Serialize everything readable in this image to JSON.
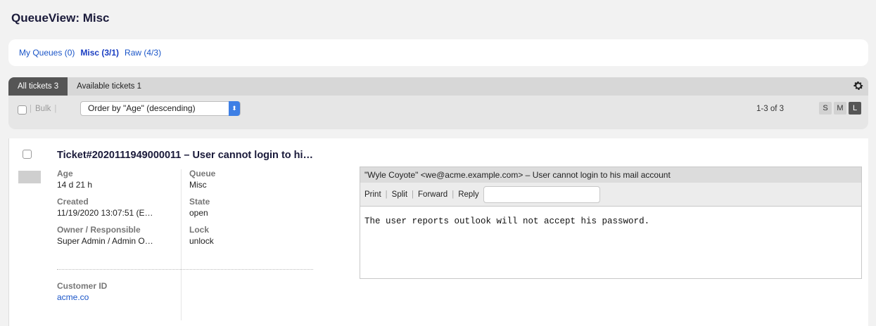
{
  "page": {
    "title": "QueueView: Misc"
  },
  "queues": [
    {
      "label": "My Queues (0)",
      "active": false
    },
    {
      "label": "Misc (3/1)",
      "active": true
    },
    {
      "label": "Raw (4/3)",
      "active": false
    }
  ],
  "tabs": {
    "all": "All tickets 3",
    "available": "Available tickets 1"
  },
  "toolbar": {
    "bulk_label": "Bulk",
    "order_by": "Order by \"Age\" (descending)",
    "pagination": "1-3 of 3",
    "sizes": [
      "S",
      "M",
      "L"
    ],
    "active_size": "L"
  },
  "ticket": {
    "title": "Ticket#2020111949000011 – User cannot login to hi…",
    "age_label": "Age",
    "age": "14 d 21 h",
    "created_label": "Created",
    "created": "11/19/2020 13:07:51 (E…",
    "owner_label": "Owner / Responsible",
    "owner": "Super Admin / Admin O…",
    "customer_id_label": "Customer ID",
    "customer_id": "acme.co",
    "queue_label": "Queue",
    "queue": "Misc",
    "state_label": "State",
    "state": "open",
    "lock_label": "Lock",
    "lock": "unlock"
  },
  "article": {
    "header": "\"Wyle Coyote\" <we@acme.example.com> – User cannot login to his mail account",
    "actions": {
      "print": "Print",
      "split": "Split",
      "forward": "Forward",
      "reply": "Reply"
    },
    "body": "The user reports outlook will not accept his password."
  },
  "colors": {
    "accent": "#1a55c8",
    "active_tab": "#555555",
    "select_arrow": "#3d7fe5"
  },
  "icons": {
    "settings": "gear-icon",
    "select": "chevron-updown-icon"
  }
}
